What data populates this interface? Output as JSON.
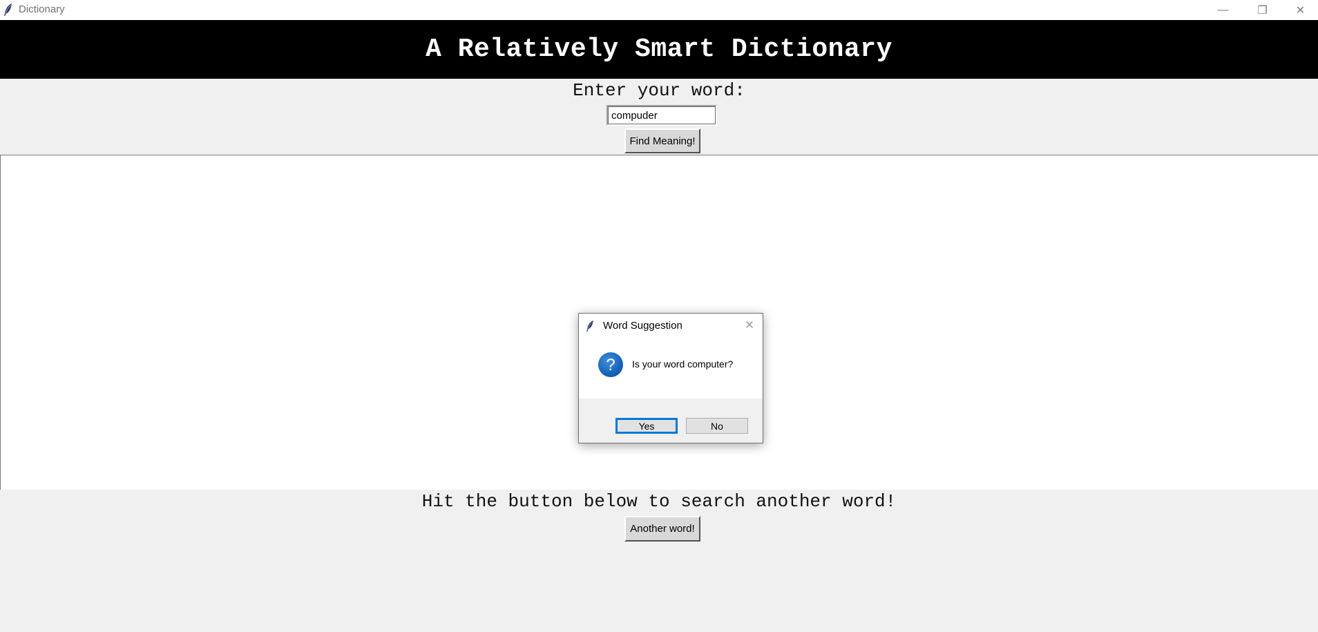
{
  "window": {
    "title": "Dictionary",
    "controls": {
      "minimize": "—",
      "maximize": "❐",
      "close": "✕"
    }
  },
  "header": {
    "title": "A Relatively Smart Dictionary"
  },
  "search": {
    "prompt": "Enter your word:",
    "value": "compuder",
    "button_label": "Find Meaning!"
  },
  "results": {
    "text": ""
  },
  "footer": {
    "prompt": "Hit the button below to search another word!",
    "button_label": "Another word!"
  },
  "dialog": {
    "title": "Word Suggestion",
    "close_glyph": "✕",
    "icon": "question-icon",
    "message": "Is your word computer?",
    "yes_label": "Yes",
    "no_label": "No"
  },
  "colors": {
    "banner": "#000000",
    "accent": "#0078d7",
    "question_icon": "#1a6fc9"
  }
}
